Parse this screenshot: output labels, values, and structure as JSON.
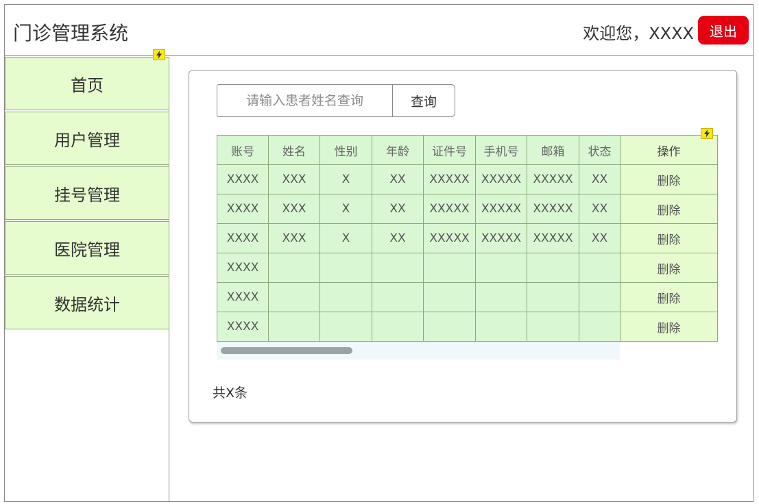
{
  "header": {
    "title": "门诊管理系统",
    "welcome": "欢迎您，XXXX",
    "logout_label": "退出"
  },
  "sidebar": {
    "items": [
      {
        "label": "首页"
      },
      {
        "label": "用户管理"
      },
      {
        "label": "挂号管理"
      },
      {
        "label": "医院管理"
      },
      {
        "label": "数据统计"
      }
    ]
  },
  "search": {
    "placeholder": "请输入患者姓名查询",
    "button_label": "查询"
  },
  "table": {
    "columns": [
      "账号",
      "姓名",
      "性别",
      "年龄",
      "证件号",
      "手机号",
      "邮箱",
      "状态",
      "操作"
    ],
    "rows": [
      [
        "XXXX",
        "XXX",
        "X",
        "XX",
        "XXXXX",
        "XXXXX",
        "XXXXX",
        "XX",
        "删除"
      ],
      [
        "XXXX",
        "XXX",
        "X",
        "XX",
        "XXXXX",
        "XXXXX",
        "XXXXX",
        "XX",
        "删除"
      ],
      [
        "XXXX",
        "XXX",
        "X",
        "XX",
        "XXXXX",
        "XXXXX",
        "XXXXX",
        "XX",
        "删除"
      ],
      [
        "XXXX",
        "",
        "",
        "",
        "",
        "",
        "",
        "",
        "删除"
      ],
      [
        "XXXX",
        "",
        "",
        "",
        "",
        "",
        "",
        "",
        "删除"
      ],
      [
        "XXXX",
        "",
        "",
        "",
        "",
        "",
        "",
        "",
        "删除"
      ]
    ]
  },
  "footer": {
    "total": "共X条"
  },
  "colors": {
    "logout_bg": "#e60012",
    "menu_bg": "#e6fccf",
    "cell_bg": "#d9f7d3",
    "cell_border": "#8ba97a"
  },
  "icons": {
    "flash": "lightning-bolt-icon"
  }
}
